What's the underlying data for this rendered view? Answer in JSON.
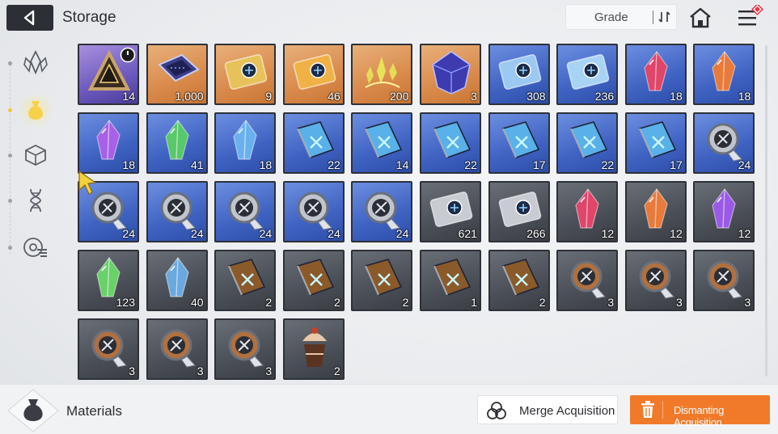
{
  "header": {
    "title": "Storage",
    "sort_label": "Grade"
  },
  "footer": {
    "category_title": "Materials",
    "merge_label": "Merge Acquisition",
    "dismantle_label": "Dismanting Acquisition"
  },
  "sidebar": {
    "items": [
      {
        "icon": "crystal-icon",
        "active": false
      },
      {
        "icon": "bag-icon",
        "active": true
      },
      {
        "icon": "cube-icon",
        "active": false
      },
      {
        "icon": "dna-icon",
        "active": false
      },
      {
        "icon": "disc-icon",
        "active": false
      }
    ]
  },
  "colors": {
    "accent_orange": "#f17a2a",
    "rarity_legendary": "#d98a4b",
    "rarity_epic": "#6d59bd",
    "rarity_rare": "#3f62c2",
    "rarity_common": "#4a4e56"
  },
  "items": [
    {
      "icon": "tri-frame-icon",
      "rarity": "purple",
      "qty": "14",
      "timer": true
    },
    {
      "icon": "chip-icon",
      "rarity": "orange",
      "qty": "1,000"
    },
    {
      "icon": "ticket-icon",
      "rarity": "orange",
      "qty": "9"
    },
    {
      "icon": "ticket-icon",
      "rarity": "orange",
      "qty": "46"
    },
    {
      "icon": "shards-icon",
      "rarity": "orange",
      "qty": "200"
    },
    {
      "icon": "cube-gem-icon",
      "rarity": "orange",
      "qty": "3"
    },
    {
      "icon": "ticket-icon",
      "rarity": "blue",
      "qty": "308"
    },
    {
      "icon": "ticket-icon",
      "rarity": "blue",
      "qty": "236"
    },
    {
      "icon": "crystal-icon",
      "rarity": "blue",
      "qty": "18"
    },
    {
      "icon": "crystal-icon",
      "rarity": "blue",
      "qty": "18"
    },
    {
      "icon": "crystal-icon",
      "rarity": "blue",
      "qty": "18"
    },
    {
      "icon": "crystal-icon",
      "rarity": "blue",
      "qty": "41"
    },
    {
      "icon": "crystal-icon",
      "rarity": "blue",
      "qty": "18"
    },
    {
      "icon": "book-icon",
      "rarity": "blue",
      "qty": "22"
    },
    {
      "icon": "book-icon",
      "rarity": "blue",
      "qty": "14"
    },
    {
      "icon": "book-icon",
      "rarity": "blue",
      "qty": "22"
    },
    {
      "icon": "book-icon",
      "rarity": "blue",
      "qty": "17"
    },
    {
      "icon": "book-icon",
      "rarity": "blue",
      "qty": "22"
    },
    {
      "icon": "book-icon",
      "rarity": "blue",
      "qty": "17"
    },
    {
      "icon": "medal-icon",
      "rarity": "blue",
      "qty": "24"
    },
    {
      "icon": "medal-icon",
      "rarity": "blue",
      "qty": "24"
    },
    {
      "icon": "medal-icon",
      "rarity": "blue",
      "qty": "24"
    },
    {
      "icon": "medal-icon",
      "rarity": "blue",
      "qty": "24"
    },
    {
      "icon": "medal-icon",
      "rarity": "blue",
      "qty": "24"
    },
    {
      "icon": "medal-icon",
      "rarity": "blue",
      "qty": "24"
    },
    {
      "icon": "ticket-icon",
      "rarity": "gray",
      "qty": "621"
    },
    {
      "icon": "ticket-icon",
      "rarity": "gray",
      "qty": "266"
    },
    {
      "icon": "crystal-icon",
      "rarity": "gray",
      "qty": "12"
    },
    {
      "icon": "crystal-icon",
      "rarity": "gray",
      "qty": "12"
    },
    {
      "icon": "crystal-icon",
      "rarity": "gray",
      "qty": "12"
    },
    {
      "icon": "crystal-icon",
      "rarity": "gray",
      "qty": "123"
    },
    {
      "icon": "crystal-icon",
      "rarity": "gray",
      "qty": "40"
    },
    {
      "icon": "book-icon",
      "rarity": "gray",
      "qty": "2"
    },
    {
      "icon": "book-icon",
      "rarity": "gray",
      "qty": "2"
    },
    {
      "icon": "book-icon",
      "rarity": "gray",
      "qty": "2"
    },
    {
      "icon": "book-icon",
      "rarity": "gray",
      "qty": "1"
    },
    {
      "icon": "book-icon",
      "rarity": "gray",
      "qty": "2"
    },
    {
      "icon": "medal-icon",
      "rarity": "gray",
      "qty": "3"
    },
    {
      "icon": "medal-icon",
      "rarity": "gray",
      "qty": "3"
    },
    {
      "icon": "medal-icon",
      "rarity": "gray",
      "qty": "3"
    },
    {
      "icon": "medal-icon",
      "rarity": "gray",
      "qty": "3"
    },
    {
      "icon": "medal-icon",
      "rarity": "gray",
      "qty": "3"
    },
    {
      "icon": "medal-icon",
      "rarity": "gray",
      "qty": "3"
    },
    {
      "icon": "drink-icon",
      "rarity": "gray",
      "qty": "2"
    }
  ],
  "item_art_colors": [
    "#c9a46a",
    "#3b3f8a",
    "#e7c25a",
    "#f0b246",
    "#e8e25a",
    "#3e3ab0",
    "#9cc9f2",
    "#a9d3f5",
    "#e0456a",
    "#e87a3a",
    "#a860e6",
    "#58c86a",
    "#6ab0ee",
    "#5ab0e8",
    "#5ab0e8",
    "#5ab0e8",
    "#5ab0e8",
    "#5ab0e8",
    "#5ab0e8",
    "#c0c4cc",
    "#c0c4cc",
    "#c0c4cc",
    "#c0c4cc",
    "#c0c4cc",
    "#c0c4cc",
    "#c8ccd2",
    "#c8ccd2",
    "#e0456a",
    "#e87a3a",
    "#9a5ae6",
    "#6ad06a",
    "#6aa8e0",
    "#8a5a2a",
    "#8a5a2a",
    "#8a5a2a",
    "#8a5a2a",
    "#8a5a2a",
    "#b07040",
    "#b07040",
    "#b07040",
    "#b07040",
    "#b07040",
    "#b07040",
    "#e8c8a8"
  ]
}
